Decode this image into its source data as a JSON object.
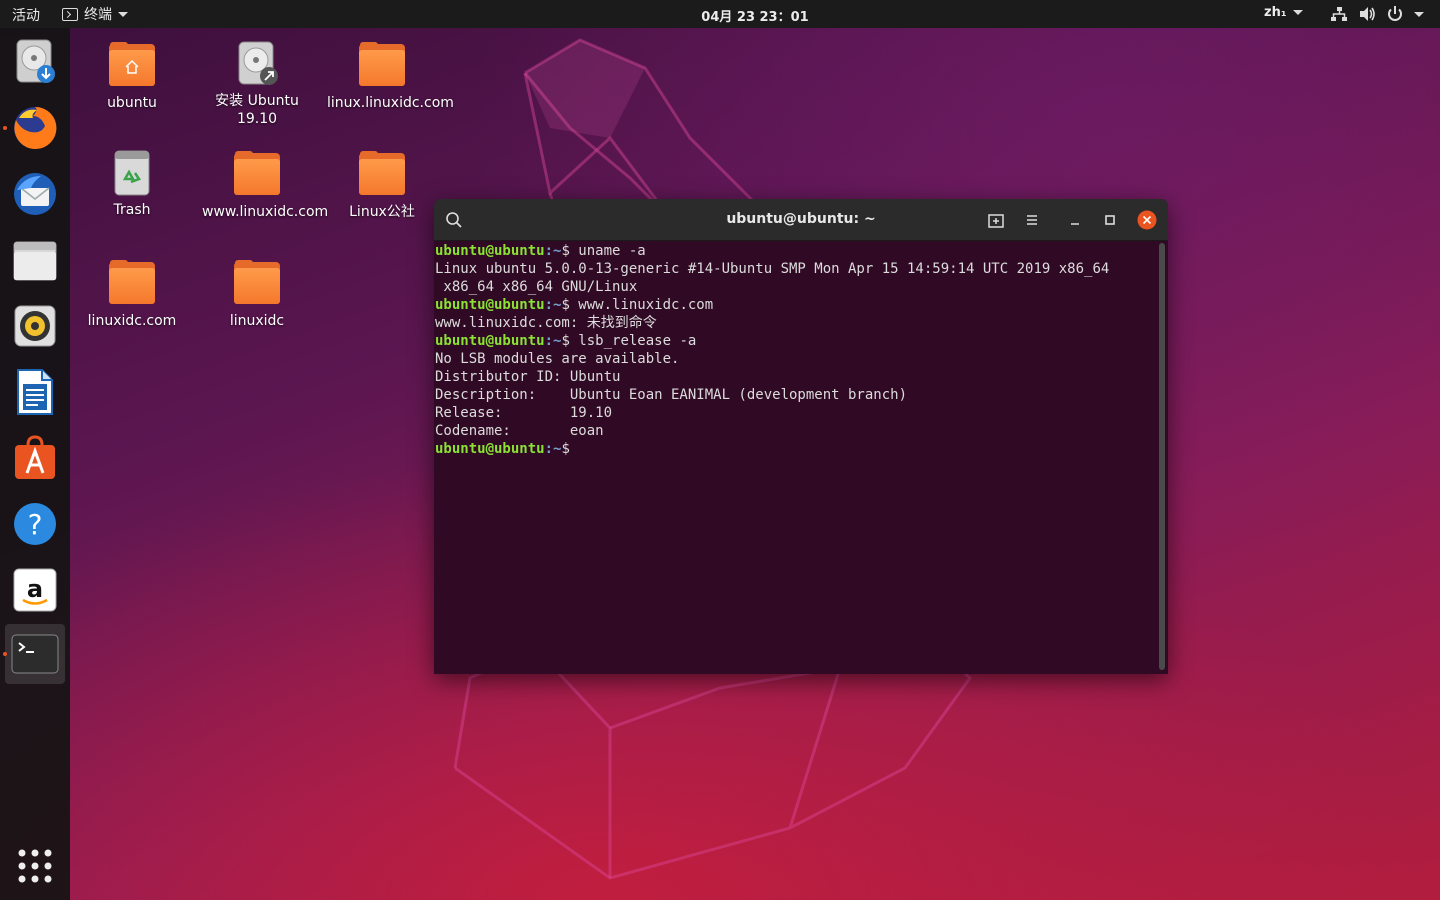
{
  "topbar": {
    "activities": "活动",
    "app_menu": "终端",
    "clock": "04月 23  23：01",
    "input_method": "zh₁"
  },
  "dock": {
    "items": [
      {
        "name": "install-ubuntu",
        "icon": "disk-install-icon"
      },
      {
        "name": "firefox",
        "icon": "firefox-icon",
        "running": true
      },
      {
        "name": "thunderbird",
        "icon": "thunderbird-icon"
      },
      {
        "name": "files",
        "icon": "files-icon"
      },
      {
        "name": "rhythmbox",
        "icon": "rhythmbox-icon"
      },
      {
        "name": "libreoffice-writer",
        "icon": "writer-icon"
      },
      {
        "name": "ubuntu-software",
        "icon": "software-icon"
      },
      {
        "name": "help",
        "icon": "help-icon"
      },
      {
        "name": "amazon",
        "icon": "amazon-icon"
      },
      {
        "name": "terminal",
        "icon": "terminal-icon",
        "running": true,
        "active": true
      }
    ],
    "show_apps": "grid-icon"
  },
  "desktop": {
    "icons": [
      {
        "label": "ubuntu",
        "type": "home-folder"
      },
      {
        "label": "安装 Ubuntu 19.10",
        "type": "installer"
      },
      {
        "label": "linux.linuxidc.com",
        "type": "folder"
      },
      {
        "label": "Trash",
        "type": "trash"
      },
      {
        "label": "www.linuxidc.com",
        "type": "folder"
      },
      {
        "label": "Linux公社",
        "type": "folder"
      },
      {
        "label": "linuxidc.com",
        "type": "folder"
      },
      {
        "label": "linuxidc",
        "type": "folder"
      }
    ]
  },
  "terminal": {
    "title": "ubuntu@ubuntu: ~",
    "prompt_user": "ubuntu@ubuntu",
    "prompt_path": ":~",
    "prompt_sign": "$ ",
    "lines": [
      {
        "type": "cmd",
        "text": "uname -a"
      },
      {
        "type": "out",
        "text": "Linux ubuntu 5.0.0-13-generic #14-Ubuntu SMP Mon Apr 15 14:59:14 UTC 2019 x86_64"
      },
      {
        "type": "out",
        "text": " x86_64 x86_64 GNU/Linux"
      },
      {
        "type": "cmd",
        "text": "www.linuxidc.com"
      },
      {
        "type": "out",
        "text": "www.linuxidc.com: 未找到命令"
      },
      {
        "type": "cmd",
        "text": "lsb_release -a"
      },
      {
        "type": "out",
        "text": "No LSB modules are available."
      },
      {
        "type": "out",
        "text": "Distributor ID:\tUbuntu"
      },
      {
        "type": "out",
        "text": "Description:\tUbuntu Eoan EANIMAL (development branch)"
      },
      {
        "type": "out",
        "text": "Release:\t19.10"
      },
      {
        "type": "out",
        "text": "Codename:\teoan"
      },
      {
        "type": "cmd",
        "text": ""
      }
    ]
  },
  "colors": {
    "accent": "#e95420",
    "terminal_bg": "#300a24",
    "prompt_user": "#8ae234",
    "prompt_path": "#729fcf"
  }
}
